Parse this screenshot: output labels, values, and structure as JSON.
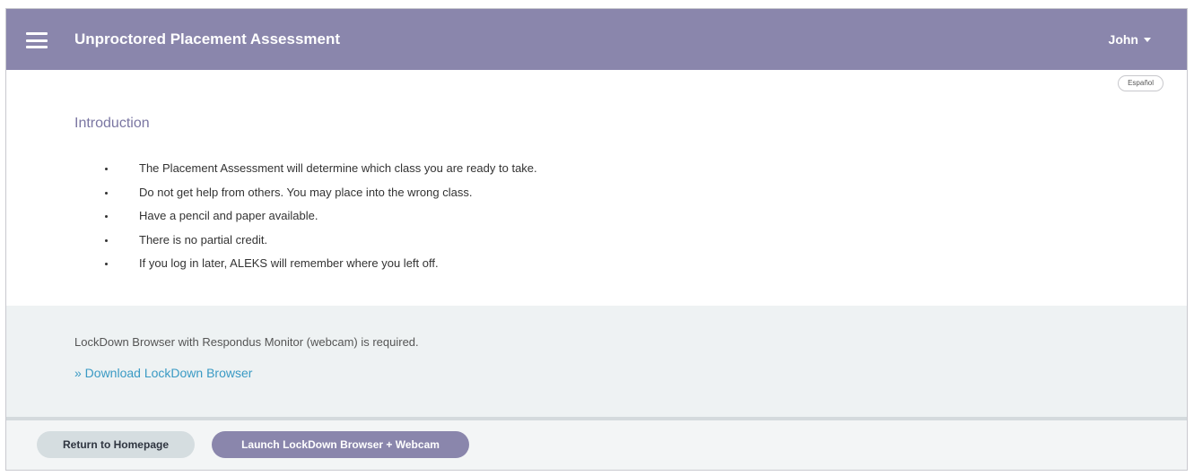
{
  "header": {
    "title": "Unproctored Placement Assessment",
    "user_name": "John"
  },
  "language_toggle": "Español",
  "intro": {
    "heading": "Introduction",
    "bullets": [
      "The Placement Assessment will determine which class you are ready to take.",
      "Do not get help from others. You may place into the wrong class.",
      "Have a pencil and paper available.",
      "There is no partial credit.",
      "If you log in later, ALEKS will remember where you left off."
    ]
  },
  "requirement": {
    "text": "LockDown Browser with Respondus Monitor (webcam) is required.",
    "download_link": "» Download LockDown Browser"
  },
  "footer": {
    "return_label": "Return to Homepage",
    "launch_label": "Launch LockDown Browser + Webcam"
  },
  "colors": {
    "header_bg": "#8a86ac",
    "link": "#3a9ac4",
    "band_bg": "#eef2f3"
  }
}
